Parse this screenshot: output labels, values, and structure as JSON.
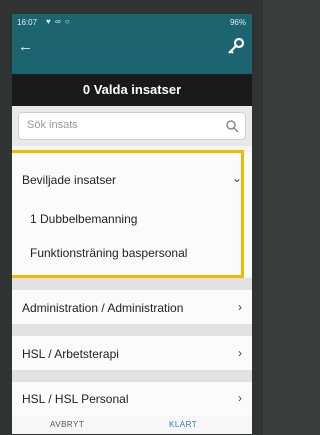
{
  "statusbar": {
    "time": "16:07",
    "battery": "96%"
  },
  "header": {
    "title": "0 Valda insatser"
  },
  "search": {
    "placeholder": "Sök insats"
  },
  "group": {
    "title": "Beviljade insatser",
    "items": [
      "1 Dubbelbemanning",
      "Funktionsträning baspersonal"
    ]
  },
  "categories": [
    {
      "label": "Administration / Administration"
    },
    {
      "label": "HSL / Arbetsterapi"
    },
    {
      "label": "HSL / HSL Personal"
    }
  ],
  "footer": {
    "cancel_label": "AVBRYT",
    "done_label": "KLART"
  },
  "colors": {
    "appbar": "#1c6470",
    "title_bg": "#1a1a1a",
    "highlight": "#f2b800",
    "done": "#1f7fbf"
  }
}
